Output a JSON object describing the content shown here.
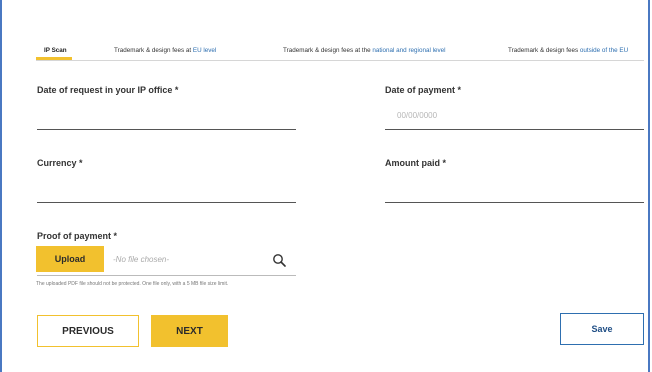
{
  "tabs": [
    {
      "text": "IP Scan",
      "highlight": ""
    },
    {
      "text": "Trademark & design fees at ",
      "highlight": "EU level"
    },
    {
      "text": "Trademark & design fees at the ",
      "highlight": "national and regional level"
    },
    {
      "text": "Trademark & design fees ",
      "highlight": "outside of the EU"
    }
  ],
  "form": {
    "date_request_label": "Date of request in your IP office *",
    "date_payment_label": "Date of payment *",
    "date_payment_placeholder": "00/00/0000",
    "currency_label": "Currency *",
    "amount_label": "Amount paid  *",
    "proof_label": "Proof of payment *",
    "upload_label": "Upload",
    "no_file_text": "-No file chosen-",
    "hint": "The uploaded PDF file should not be protected. One file only, with a 5 MB file size limit."
  },
  "actions": {
    "previous": "PREVIOUS",
    "next": "NEXT",
    "save": "Save"
  },
  "colors": {
    "accent": "#f2c12e",
    "link": "#2e6fb0",
    "frame": "#4a78c2"
  }
}
